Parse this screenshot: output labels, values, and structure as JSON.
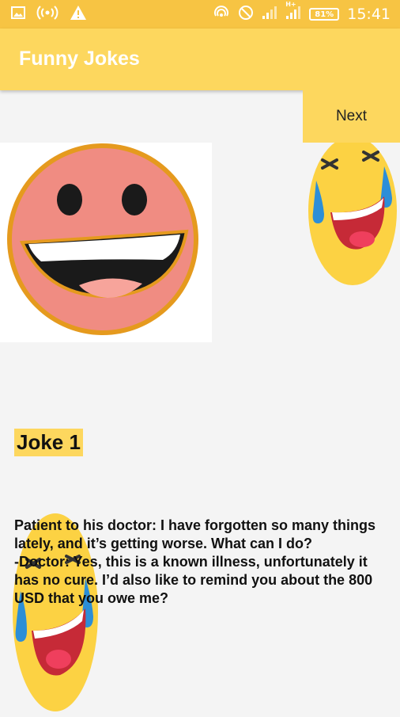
{
  "status_bar": {
    "time": "15:41",
    "battery": "81%",
    "network": "H+",
    "icons_left": [
      "image-icon",
      "hotspot-icon",
      "warning-icon"
    ],
    "icons_right": [
      "nfc-icon",
      "do-not-disturb-icon",
      "signal-icon",
      "signal-h-plus-icon",
      "battery-icon"
    ]
  },
  "app_bar": {
    "title": "Funny Jokes"
  },
  "next_button": {
    "label": "Next"
  },
  "joke": {
    "title": "Joke 1",
    "text": "Patient to his doctor: I have forgotten so many things lately, and it’s getting worse. What can I do?\n-Doctor: Yes, this is a known illness, unfortunately it has no cure. I’d also like to remind you about the 800 USD that you owe me?"
  },
  "colors": {
    "status_bar": "#f7c443",
    "app_bar": "#fdd75e",
    "background": "#f4f4f4",
    "emoji_yellow": "#fcd243",
    "emoji_pink": "#f08c82",
    "emoji_outline": "#e59a1e",
    "tear_blue": "#2c8ed7"
  }
}
